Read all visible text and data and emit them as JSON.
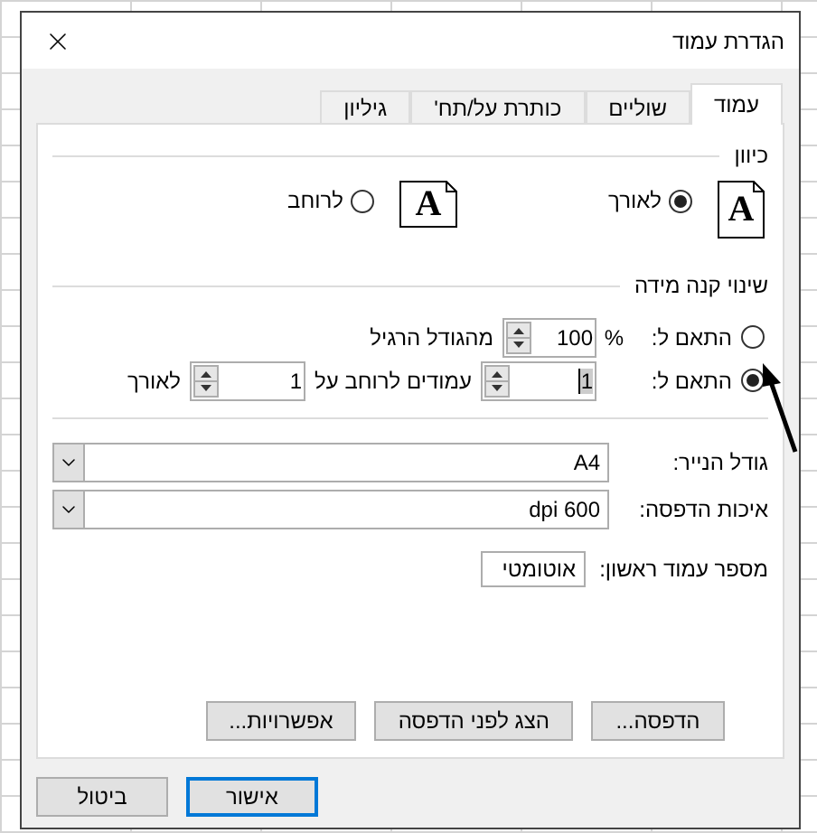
{
  "window": {
    "title": "הגדרת עמוד"
  },
  "tabs": [
    {
      "label": "עמוד",
      "selected": true
    },
    {
      "label": "שוליים",
      "selected": false
    },
    {
      "label": "כותרת על/תח'",
      "selected": false
    },
    {
      "label": "גיליון",
      "selected": false
    }
  ],
  "orientation": {
    "title": "כיוון",
    "options": [
      {
        "kind": "portrait",
        "glyph": "A",
        "label": "לאורך",
        "selected": true
      },
      {
        "kind": "landscape",
        "glyph": "A",
        "label": "לרוחב",
        "selected": false
      }
    ]
  },
  "scaling": {
    "title": "שינוי קנה מידה",
    "options": [
      {
        "kind": "percent",
        "label": "התאם ל:",
        "selected": false,
        "unit": "%",
        "value": "100",
        "suffix": "מהגודל הרגיל"
      },
      {
        "kind": "fit",
        "label": "התאם ל:",
        "selected": true,
        "wide_value": "1",
        "wide_label": "עמודים לרוחב על",
        "tall_value": "1",
        "tall_label": "לאורך"
      }
    ]
  },
  "paper_size": {
    "label": "גודל הנייר:",
    "value": "A4"
  },
  "print_quality": {
    "label": "איכות הדפסה:",
    "value": "600 dpi"
  },
  "first_page_number": {
    "label": "מספר עמוד ראשון:",
    "value": "אוטומטי"
  },
  "panel_buttons": [
    "הדפסה...",
    "הצג לפני הדפסה",
    "אפשרויות..."
  ],
  "footer_buttons": [
    {
      "label": "אישור",
      "default": true
    },
    {
      "label": "ביטול",
      "default": false
    }
  ]
}
